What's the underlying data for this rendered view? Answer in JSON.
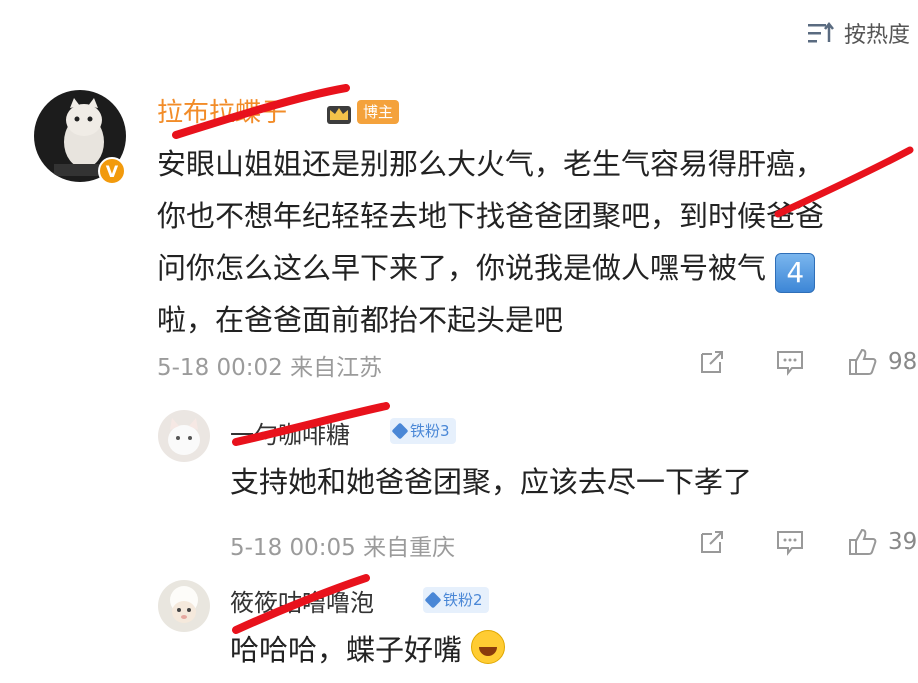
{
  "sort": {
    "label": "按热度"
  },
  "main_comment": {
    "username": "拉布拉蝶子",
    "badge": "博主",
    "verified_mark": "V",
    "lines": [
      "安眼山姐姐还是别那么大火气，老生气容易得肝癌，",
      "你也不想年纪轻轻去地下找爸爸团聚吧，到时候爸爸",
      "问你怎么这么早下来了，你说我是做人嘿号被气",
      "啦，在爸爸面前都抬不起头是吧"
    ],
    "emoji_number": "4",
    "time": "5-18 00:02 来自江苏",
    "like_count": "98"
  },
  "replies": [
    {
      "username": "一勺咖啡糖",
      "fan_badge": "铁粉3",
      "text": "支持她和她爸爸团聚，应该去尽一下孝了",
      "time": "5-18 00:05 来自重庆",
      "like_count": "39"
    },
    {
      "username": "筱筱咕噜噜泡",
      "fan_badge": "铁粉2",
      "text": "哈哈哈，蝶子好嘴"
    }
  ],
  "icons": {
    "sort": "sort-icon",
    "share": "share-icon",
    "comment": "comment-icon",
    "like": "thumbs-up-icon",
    "crown": "crown-icon",
    "laugh": "laugh-cry-emoji"
  },
  "colors": {
    "main_username": "#f28c28",
    "badge_bg": "#f4a23c",
    "fan_badge_bg": "#e6f0fc",
    "fan_badge_text": "#4a87d6",
    "meta_text": "#9b9b9b",
    "redact_line": "#e8121c"
  }
}
